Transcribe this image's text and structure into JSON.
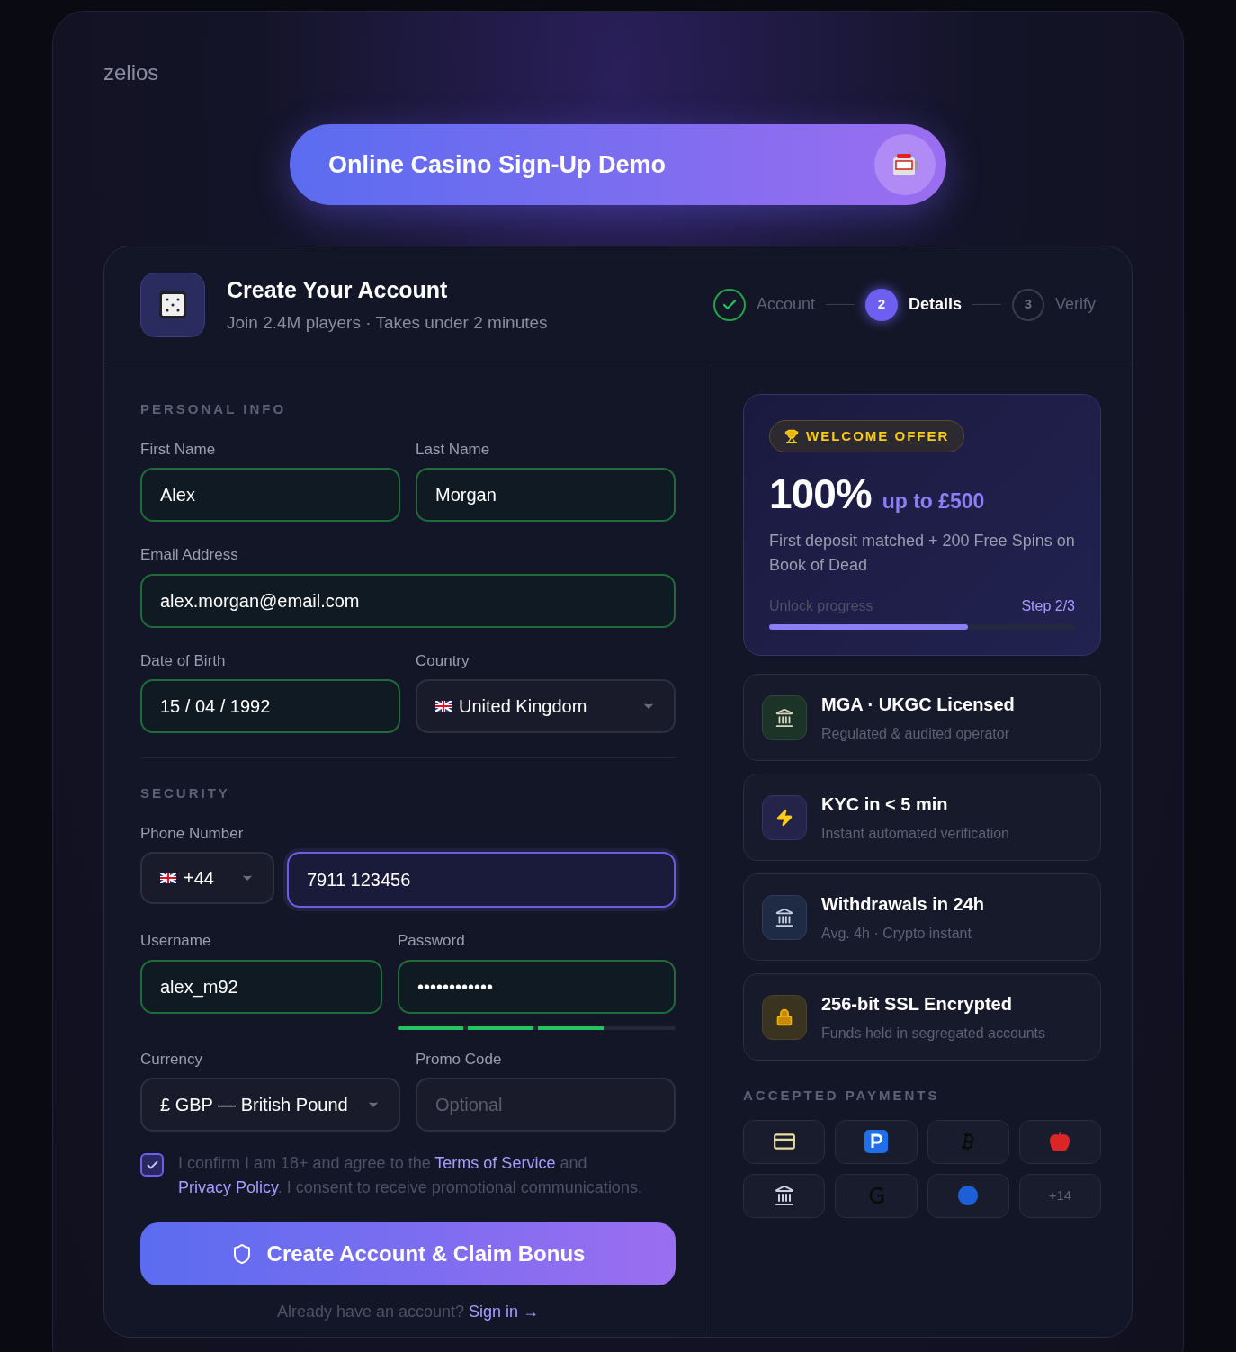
{
  "brand": "zelios",
  "banner": {
    "title": "Online Casino Sign-Up Demo"
  },
  "header": {
    "title": "Create Your Account",
    "subtitle": "Join 2.4M players · Takes under 2 minutes",
    "steps": [
      {
        "label": "Account",
        "done": true,
        "selected": false
      },
      {
        "number": "2",
        "label": "Details",
        "done": false,
        "selected": true
      },
      {
        "number": "3",
        "label": "Verify",
        "done": false,
        "selected": false
      }
    ]
  },
  "personal": {
    "heading": "PERSONAL INFO",
    "rows": [
      [
        {
          "kind": "text",
          "label": "First Name",
          "value": "Alex",
          "valid": true
        },
        {
          "kind": "text",
          "label": "Last Name",
          "value": "Morgan",
          "valid": true
        }
      ],
      [
        {
          "kind": "text",
          "label": "Email Address",
          "value": "alex.morgan@email.com",
          "valid": true
        }
      ],
      [
        {
          "kind": "text",
          "label": "Date of Birth",
          "value": "15 / 04 / 1992",
          "valid": true
        },
        {
          "kind": "country",
          "label": "Country",
          "value": "United Kingdom",
          "valid": false
        }
      ]
    ]
  },
  "security": {
    "heading": "SECURITY",
    "phone_label": "Phone Number",
    "dial_code": "+44",
    "phone": {
      "value": "7911 123456",
      "focused": true
    },
    "username": {
      "label": "Username",
      "value": "alex_m92",
      "valid": true
    },
    "password": {
      "label": "Password",
      "value": "••••••••••••",
      "valid": true,
      "strength": {
        "level": 0.75
      }
    },
    "currency": {
      "kind": "select",
      "label": "Currency",
      "value": "£ GBP — British Pound",
      "valid": false
    },
    "promo": {
      "label": "Promo Code",
      "placeholder": "Optional",
      "valid": false
    }
  },
  "consent": {
    "checked": true,
    "text_before": "I confirm I am 18+ and agree to the",
    "link_terms": "Terms of Service",
    "text_and": "and",
    "link_privacy": "Privacy Policy",
    "text_after": ". I consent to receive promotional communications."
  },
  "submit": "Create Account & Claim Bonus",
  "signin": {
    "prompt": "Already have an account?",
    "link": "Sign in →"
  },
  "offer": {
    "badge": "WELCOME OFFER",
    "amount": "100%",
    "up_to": "up to £500",
    "description": "First deposit matched + 200 Free Spins on Book of Dead",
    "progress_label": "Unlock progress",
    "progress_step": "Step 2/3",
    "level": 0.65
  },
  "features": [
    {
      "kind": "licensed",
      "title": "MGA · UKGC Licensed",
      "subtitle": "Regulated & audited operator"
    },
    {
      "kind": "kyc",
      "title": "KYC in < 5 min",
      "subtitle": "Instant automated verification"
    },
    {
      "kind": "withdrawals",
      "title": "Withdrawals in 24h",
      "subtitle": "Avg. 4h · Crypto instant"
    },
    {
      "kind": "ssl",
      "title": "256-bit SSL Encrypted",
      "subtitle": "Funds held in segregated accounts"
    }
  ],
  "payments": {
    "heading": "ACCEPTED PAYMENTS",
    "items": [
      {
        "kind": "card"
      },
      {
        "kind": "parking"
      },
      {
        "kind": "bitcoin"
      },
      {
        "kind": "apple"
      },
      {
        "kind": "bank"
      },
      {
        "kind": "letter"
      },
      {
        "kind": "circle"
      },
      {
        "kind": "more",
        "text": "+14"
      }
    ]
  }
}
